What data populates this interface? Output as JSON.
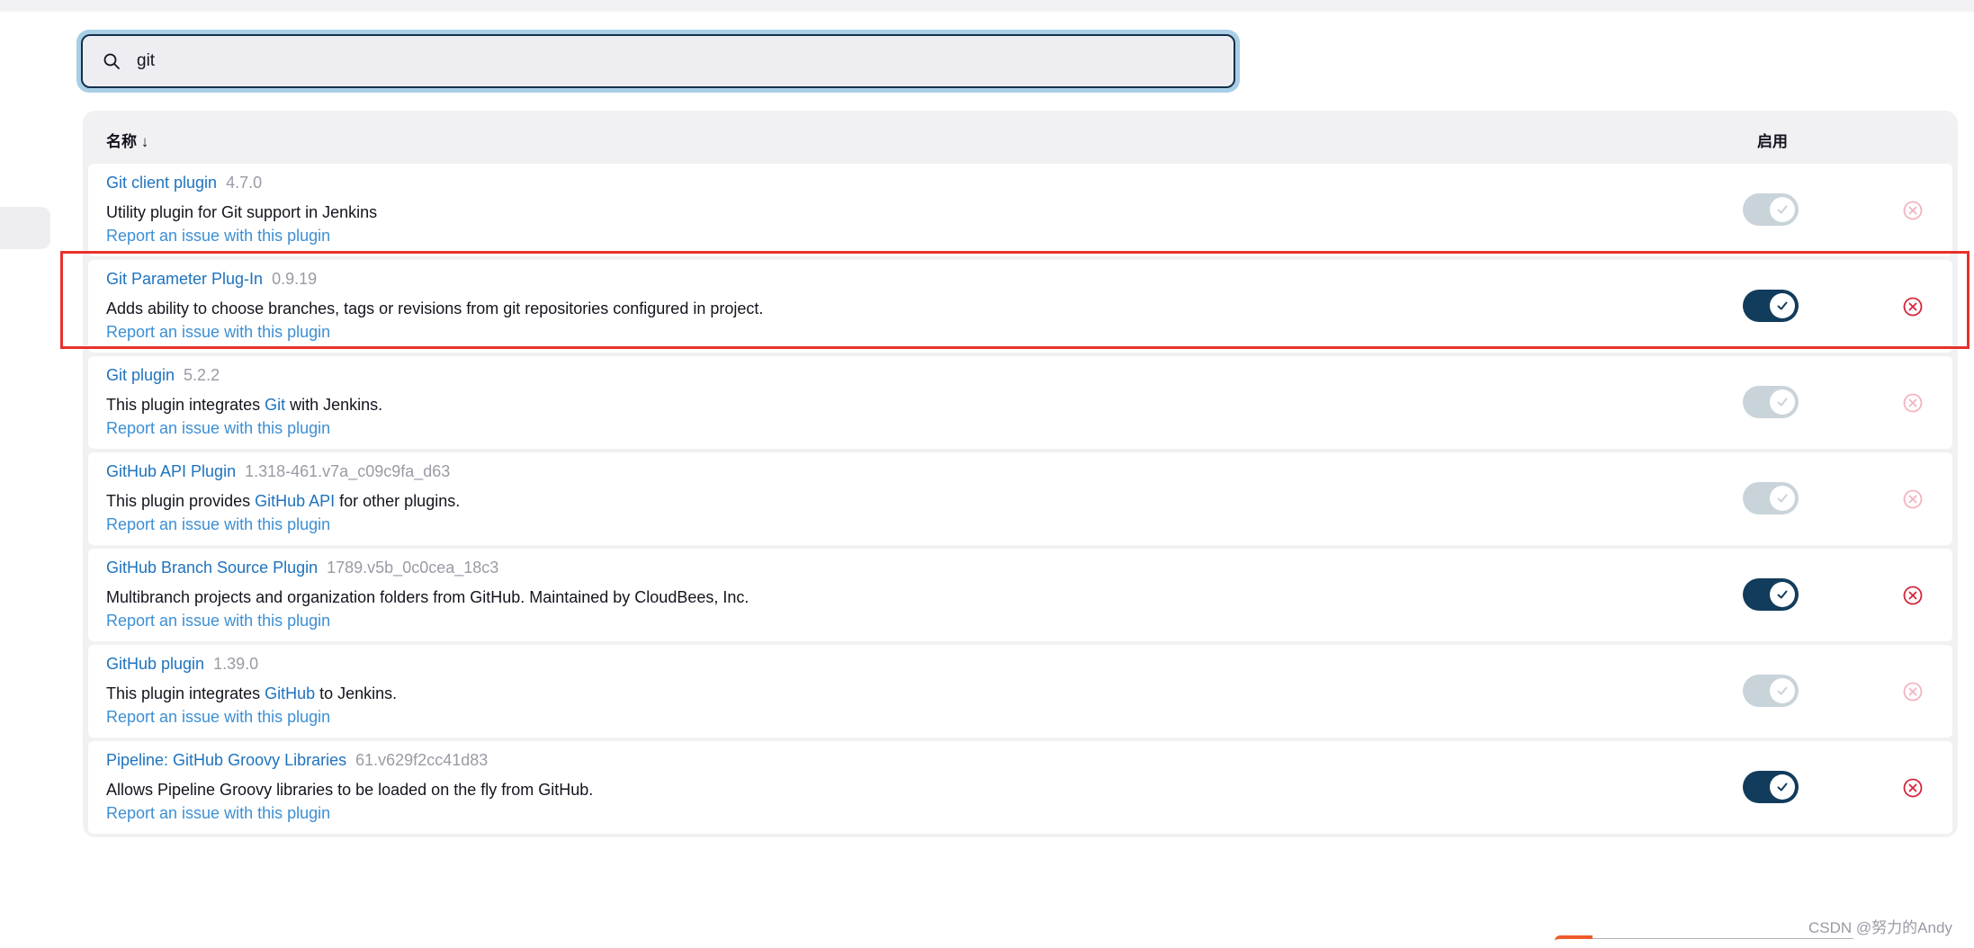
{
  "search": {
    "value": "git"
  },
  "table": {
    "header_name": "名称  ↓",
    "header_enabled": "启用"
  },
  "plugins": [
    {
      "name": "Git client plugin",
      "version": "4.7.0",
      "desc_pre": "Utility plugin for Git support in Jenkins",
      "desc_link": "",
      "desc_post": "",
      "report": "Report an issue with this plugin",
      "enabled": true,
      "toggle_editable": false,
      "uninstallable": false
    },
    {
      "name": "Git Parameter Plug-In",
      "version": "0.9.19",
      "desc_pre": "Adds ability to choose branches, tags or revisions from git repositories configured in project.",
      "desc_link": "",
      "desc_post": "",
      "report": "Report an issue with this plugin",
      "enabled": true,
      "toggle_editable": true,
      "uninstallable": true
    },
    {
      "name": "Git plugin",
      "version": "5.2.2",
      "desc_pre": "This plugin integrates ",
      "desc_link": "Git",
      "desc_post": " with Jenkins.",
      "report": "Report an issue with this plugin",
      "enabled": true,
      "toggle_editable": false,
      "uninstallable": false
    },
    {
      "name": "GitHub API Plugin",
      "version": "1.318-461.v7a_c09c9fa_d63",
      "desc_pre": "This plugin provides ",
      "desc_link": "GitHub API",
      "desc_post": " for other plugins.",
      "report": "Report an issue with this plugin",
      "enabled": true,
      "toggle_editable": false,
      "uninstallable": false
    },
    {
      "name": "GitHub Branch Source Plugin",
      "version": "1789.v5b_0c0cea_18c3",
      "desc_pre": "Multibranch projects and organization folders from GitHub. Maintained by CloudBees, Inc.",
      "desc_link": "",
      "desc_post": "",
      "report": "Report an issue with this plugin",
      "enabled": true,
      "toggle_editable": true,
      "uninstallable": true
    },
    {
      "name": "GitHub plugin",
      "version": "1.39.0",
      "desc_pre": "This plugin integrates ",
      "desc_link": "GitHub",
      "desc_post": " to Jenkins.",
      "report": "Report an issue with this plugin",
      "enabled": true,
      "toggle_editable": false,
      "uninstallable": false
    },
    {
      "name": "Pipeline: GitHub Groovy Libraries",
      "version": "61.v629f2cc41d83",
      "desc_pre": "Allows Pipeline Groovy libraries to be loaded on the fly from GitHub.",
      "desc_link": "",
      "desc_post": "",
      "report": "Report an issue with this plugin",
      "enabled": true,
      "toggle_editable": true,
      "uninstallable": true
    }
  ],
  "colors": {
    "link": "#1e73be",
    "toggle_on": "#123c5c",
    "toggle_disabled": "#c9d3da",
    "delete_active": "#d6243b",
    "delete_disabled": "#f3b3bd",
    "highlight": "#e8322b"
  },
  "icons": {
    "search": "search-icon",
    "toggle_knob": "check-icon",
    "delete": "circle-x-icon"
  },
  "watermark": "CSDN @努力的Andy"
}
